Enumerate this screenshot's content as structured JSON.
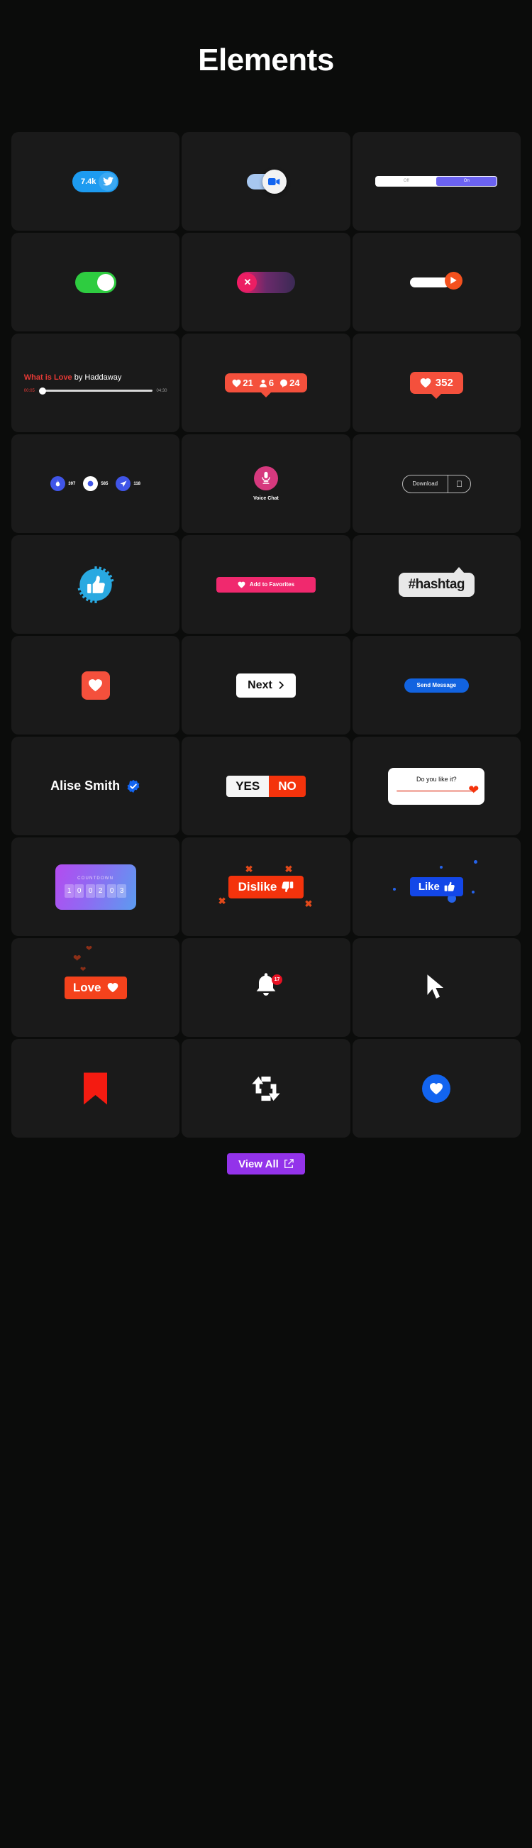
{
  "header": {
    "title": "Elements"
  },
  "footer": {
    "view_all_label": "View All",
    "view_all_icon": "external-link-icon",
    "accent": "#9333ea"
  },
  "cards": {
    "twitter_pill": {
      "count": "7.4k",
      "icon": "twitter-bird-icon",
      "color": "#1d9bf0"
    },
    "zoom_toggle": {
      "icon": "video-camera-icon",
      "state": "on",
      "track_color": "#a7c7f0"
    },
    "off_on_switch": {
      "off_label": "Off",
      "on_label": "On",
      "selected": "On",
      "on_color": "#6b62f0"
    },
    "green_toggle": {
      "state": "on",
      "color": "#2ecc40"
    },
    "gradient_toggle": {
      "icon": "close-icon",
      "state": "off",
      "knob_color": "#ec1e63"
    },
    "play_toggle": {
      "icon": "play-icon",
      "state": "on",
      "knob_color": "#f4511e"
    },
    "music_player": {
      "song": "What is Love",
      "by": " by Haddaway",
      "current_time": "00:05",
      "total_time": "04:30",
      "progress_percent": 3,
      "accent": "#e53935"
    },
    "ig_stats": {
      "likes": "21",
      "followers": "6",
      "comments": "24",
      "like_icon": "heart-icon",
      "follower_icon": "person-icon",
      "comment_icon": "comment-icon",
      "color": "#f4503c"
    },
    "like_tooltip": {
      "count": "352",
      "icon": "heart-icon",
      "color": "#f4503c"
    },
    "social_counters": {
      "items": [
        {
          "icon": "fire-icon",
          "count": "397",
          "style": "blue"
        },
        {
          "icon": "clap-icon",
          "count": "585",
          "style": "white"
        },
        {
          "icon": "send-icon",
          "count": "118",
          "style": "blue"
        }
      ]
    },
    "voice_chat": {
      "label": "Voice Chat",
      "icon": "microphone-icon",
      "color": "#d6397e"
    },
    "download": {
      "label": "Download",
      "icon": "apple-logo-icon"
    },
    "verified_thumb": {
      "icon": "thumbs-up-icon",
      "color": "#29a9e1"
    },
    "add_to_favorites": {
      "label": "Add to Favorites",
      "icon": "heart-icon",
      "color": "#f0296e"
    },
    "hashtag": {
      "label": "#hashtag"
    },
    "heart_square": {
      "icon": "heart-icon",
      "color": "#f4503c"
    },
    "next_button": {
      "label": "Next",
      "icon": "chevron-right-icon"
    },
    "send_message": {
      "label": "Send Message",
      "color": "#1263e0"
    },
    "verified_user": {
      "name": "Alise Smith",
      "icon": "verified-badge-icon"
    },
    "yes_no": {
      "yes_label": "YES",
      "no_label": "NO",
      "selected": "NO",
      "no_color": "#f4330c"
    },
    "do_you_like_it": {
      "question": "Do you like it?",
      "icon": "heart-icon",
      "value_percent": 100
    },
    "countdown": {
      "label": "COUNTDOWN",
      "digits": [
        "1",
        "0",
        "0",
        "2",
        "0",
        "3"
      ]
    },
    "dislike": {
      "label": "Dislike",
      "icon": "thumbs-down-icon",
      "color": "#f4330c"
    },
    "like": {
      "label": "Like",
      "icon": "thumbs-up-icon",
      "color": "#1347e8"
    },
    "love": {
      "label": "Love",
      "icon": "heart-icon",
      "color": "#f4421c"
    },
    "notification_bell": {
      "icon": "bell-icon",
      "badge_count": "17",
      "badge_color": "#e81123"
    },
    "cursor": {
      "icon": "cursor-arrow-icon"
    },
    "bookmark": {
      "icon": "bookmark-icon",
      "color": "#f41b11"
    },
    "retweet": {
      "icon": "retweet-icon"
    },
    "blue_heart": {
      "icon": "heart-icon",
      "color": "#1264f0"
    }
  }
}
